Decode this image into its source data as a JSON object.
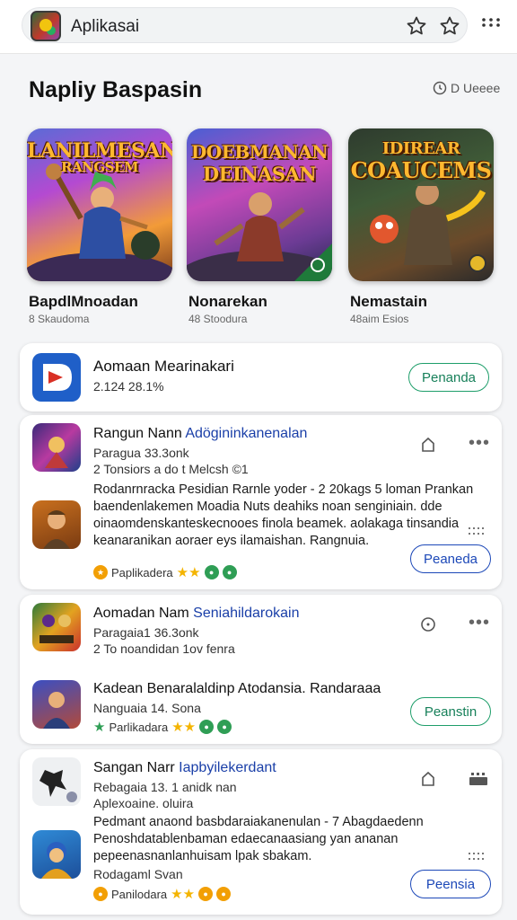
{
  "topbar": {
    "search_text": "Aplikasai"
  },
  "section": {
    "title": "Napliy Baspasin",
    "more_label": "D Ueeee"
  },
  "featured": [
    {
      "art_title": "LANILMESAN",
      "art_sub": "RANGSEM",
      "name": "BapdlMnoadan",
      "sub": "8 Skaudoma"
    },
    {
      "art_title": "DOEBMANAN",
      "art_sub": "DEINASAN",
      "name": "Nonarekan",
      "sub": "48 Stoodura"
    },
    {
      "art_title": "IDIREAR",
      "art_sub": "COAUCEMS",
      "name": "Nemastain",
      "sub": "48aim Esios"
    }
  ],
  "app_row": {
    "title": "Aomaan Mearinakari",
    "sub": "2.124 28.1%",
    "button": "Penanda"
  },
  "cards": [
    {
      "title_a": "Rangun Nann",
      "title_b": "Adögininkanenalan",
      "sub1": "Paragua 33.3onk",
      "sub2": "2 Tonsiors a do t Melcsh ©1",
      "desc": "Rodanrnracka Pesidian Rarnle yoder - 2 20kags 5 loman Prankan baendenlakemen Moadia Nuts deahiks noan senginiain. dde oinaomdenskanteskecnooes finola beamek. aolakaga tinsandia keanaranikan aoraer eys ilamaishan. Rangnuia.",
      "rating": "Paplikadera",
      "button": "Peaneda"
    },
    {
      "title_a": "Aomadan Nam",
      "title_b": "Seniahildarokain",
      "sub1": "Paragaia1 36.3onk",
      "sub2": "2 To noandidan 1ov fenra",
      "desc": "Kadean Benaralaldinp Atodansia. Randaraaa",
      "sub3": "Nanguaia 14. Sona",
      "rating": "Parlikadara",
      "button": "Peanstin"
    },
    {
      "title_a": "Sangan Narr",
      "title_b": "Iapbyilekerdant",
      "sub1": "Rebagaia 13. 1 anidk nan",
      "sub2": "Aplexoaine. oluira",
      "desc": "Pedmant anaond basbdaraiakanenulan - 7 Abagdaedenn Penoshdatablenbaman edaecanaasiang yan ananan pepeenasnanlanhuisam lpak sbakam.",
      "sub3": "Rodagaml Svan",
      "rating": "Panilodara",
      "button": "Peensia"
    }
  ]
}
